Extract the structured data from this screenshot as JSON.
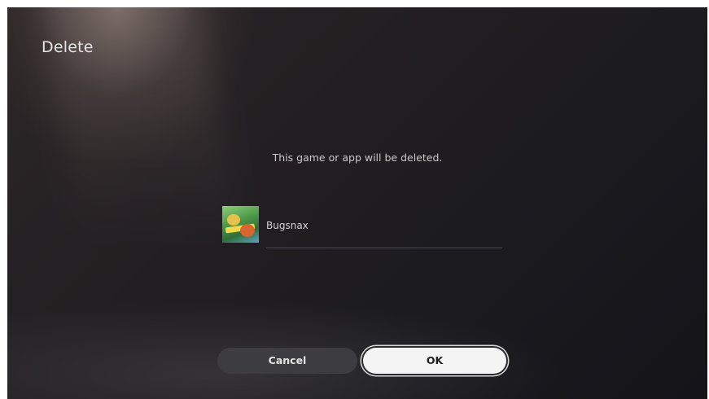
{
  "header": {
    "title": "Delete"
  },
  "dialog": {
    "message": "This game or app will be deleted.",
    "items": [
      {
        "name": "Bugsnax",
        "icon": "bugsnax-game-icon"
      }
    ]
  },
  "buttons": {
    "cancel_label": "Cancel",
    "ok_label": "OK"
  },
  "colors": {
    "background": "#1c1b20",
    "button_focused": "#f4f4f4",
    "button_default": "#3d3c40"
  }
}
